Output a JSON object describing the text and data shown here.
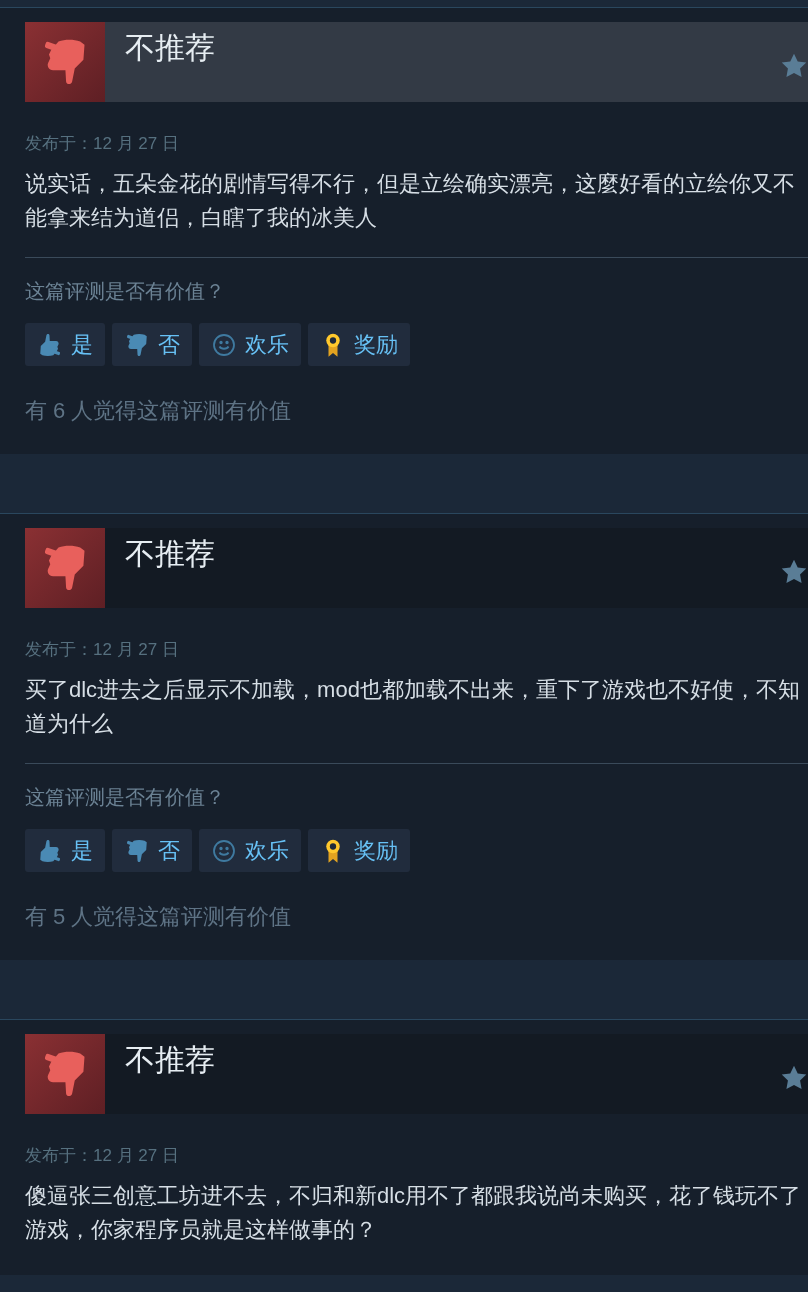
{
  "reviews": [
    {
      "title": "不推荐",
      "highlighted": true,
      "date": "发布于：12 月 27 日",
      "text": "说实话，五朵金花的剧情写得不行，但是立绘确实漂亮，这麼好看的立绘你又不能拿来结为道侣，白瞎了我的冰美人",
      "question": "这篇评测是否有价值？",
      "buttons": [
        {
          "kind": "yes",
          "label": "是"
        },
        {
          "kind": "no",
          "label": "否"
        },
        {
          "kind": "funny",
          "label": "欢乐"
        },
        {
          "kind": "award",
          "label": "奖励"
        }
      ],
      "helpful": "有 6 人觉得这篇评测有价值"
    },
    {
      "title": "不推荐",
      "highlighted": false,
      "date": "发布于：12 月 27 日",
      "text": "买了dlc进去之后显示不加载，mod也都加载不出来，重下了游戏也不好使，不知道为什么",
      "question": "这篇评测是否有价值？",
      "buttons": [
        {
          "kind": "yes",
          "label": "是"
        },
        {
          "kind": "no",
          "label": "否"
        },
        {
          "kind": "funny",
          "label": "欢乐"
        },
        {
          "kind": "award",
          "label": "奖励"
        }
      ],
      "helpful": "有 5 人觉得这篇评测有价值"
    },
    {
      "title": "不推荐",
      "highlighted": false,
      "date": "发布于：12 月 27 日",
      "text": "傻逼张三创意工坊进不去，不归和新dlc用不了都跟我说尚未购买，花了钱玩不了游戏，你家程序员就是这样做事的？"
    }
  ]
}
